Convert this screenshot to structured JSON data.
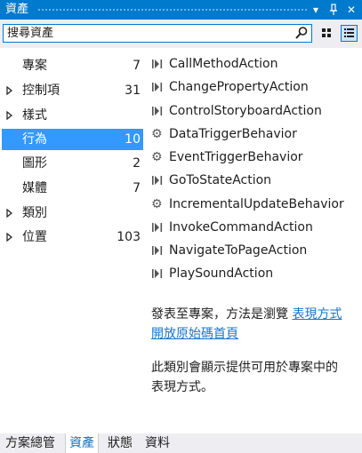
{
  "window": {
    "title": "資產"
  },
  "search": {
    "placeholder": "搜尋資產"
  },
  "categories": [
    {
      "label": "專案",
      "count": "7",
      "expandable": false,
      "selected": false
    },
    {
      "label": "控制項",
      "count": "31",
      "expandable": true,
      "selected": false
    },
    {
      "label": "樣式",
      "count": "",
      "expandable": true,
      "selected": false
    },
    {
      "label": "行為",
      "count": "10",
      "expandable": false,
      "selected": true
    },
    {
      "label": "圖形",
      "count": "2",
      "expandable": false,
      "selected": false
    },
    {
      "label": "媒體",
      "count": "7",
      "expandable": false,
      "selected": false
    },
    {
      "label": "類別",
      "count": "",
      "expandable": true,
      "selected": false
    },
    {
      "label": "位置",
      "count": "103",
      "expandable": true,
      "selected": false
    }
  ],
  "items": [
    {
      "label": "CallMethodAction",
      "icon": "action-icon"
    },
    {
      "label": "ChangePropertyAction",
      "icon": "action-icon"
    },
    {
      "label": "ControlStoryboardAction",
      "icon": "action-icon"
    },
    {
      "label": "DataTriggerBehavior",
      "icon": "gear-icon"
    },
    {
      "label": "EventTriggerBehavior",
      "icon": "gear-icon"
    },
    {
      "label": "GoToStateAction",
      "icon": "action-icon"
    },
    {
      "label": "IncrementalUpdateBehavior",
      "icon": "gear-icon"
    },
    {
      "label": "InvokeCommandAction",
      "icon": "action-icon"
    },
    {
      "label": "NavigateToPageAction",
      "icon": "action-icon"
    },
    {
      "label": "PlaySoundAction",
      "icon": "action-icon"
    }
  ],
  "info": {
    "line1_text": "發表至專案，方法是瀏覽",
    "link_text1": "表現方式",
    "link_text2": "開放原始碼首頁",
    "line2_a": "此類別會顯示提供可用於專案中的",
    "line2_b": "表現方式。"
  },
  "tabs": [
    {
      "label": "方案總管",
      "active": false
    },
    {
      "label": "資產",
      "active": true
    },
    {
      "label": "狀態",
      "active": false
    },
    {
      "label": "資料",
      "active": false
    }
  ],
  "colors": {
    "accent": "#007acc",
    "selected": "#3399ff",
    "link": "#1a74c7"
  }
}
